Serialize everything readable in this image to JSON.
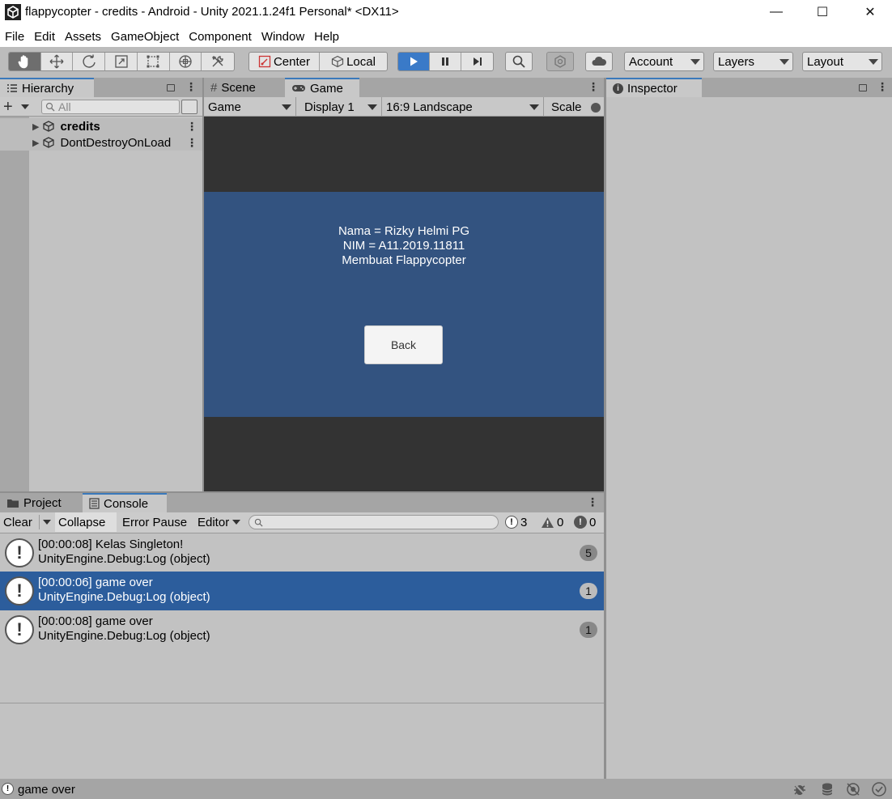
{
  "window": {
    "title": "flappycopter - credits - Android - Unity 2021.1.24f1 Personal* <DX11>",
    "minimize": "—",
    "maximize": "☐",
    "close": "✕"
  },
  "menu": [
    "File",
    "Edit",
    "Assets",
    "GameObject",
    "Component",
    "Window",
    "Help"
  ],
  "toolbar": {
    "center_label": "Center",
    "local_label": "Local",
    "account_label": "Account",
    "layers_label": "Layers",
    "layout_label": "Layout"
  },
  "hierarchy": {
    "tab_label": "Hierarchy",
    "search_placeholder": "All",
    "items": [
      {
        "label": "credits"
      },
      {
        "label": "DontDestroyOnLoad"
      }
    ]
  },
  "scene_tab": {
    "label": "Scene"
  },
  "game_tab": {
    "label": "Game",
    "mode": "Game",
    "display": "Display 1",
    "aspect": "16:9 Landscape",
    "scale_label": "Scale"
  },
  "game": {
    "line1": "Nama = Rizky Helmi PG",
    "line2": "NIM = A11.2019.11811",
    "line3": "Membuat Flappycopter",
    "back_button": "Back"
  },
  "inspector": {
    "tab_label": "Inspector"
  },
  "project_tab": {
    "label": "Project"
  },
  "console": {
    "tab_label": "Console",
    "clear": "Clear",
    "collapse": "Collapse",
    "error_pause": "Error Pause",
    "editor": "Editor",
    "log_count": "3",
    "warn_count": "0",
    "error_count": "0",
    "entries": [
      {
        "line1": "[00:00:08] Kelas Singleton!",
        "line2": "UnityEngine.Debug:Log (object)",
        "count": "5"
      },
      {
        "line1": "[00:00:06] game over",
        "line2": "UnityEngine.Debug:Log (object)",
        "count": "1"
      },
      {
        "line1": "[00:00:08] game over",
        "line2": "UnityEngine.Debug:Log (object)",
        "count": "1"
      }
    ]
  },
  "status": {
    "message": "game over"
  },
  "colors": {
    "accent": "#3a7ac8",
    "selection": "#2c5d9c",
    "game_bg": "#335380"
  }
}
